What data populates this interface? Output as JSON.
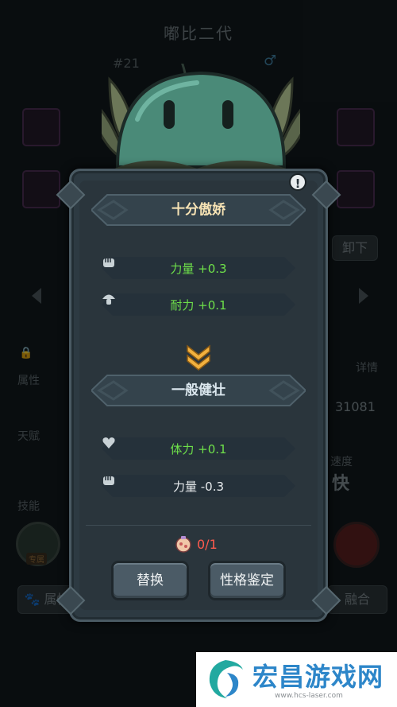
{
  "background": {
    "title": "嘟比二代",
    "number": "#21",
    "gender": "♂",
    "unequip_button": "卸下",
    "labels": {
      "attributes": "属性",
      "talent": "天赋",
      "skill": "技能",
      "details": "详情",
      "speed": "速度"
    },
    "values": {
      "power": "31081",
      "speed": "快"
    },
    "bottom_left_button": "属性",
    "bottom_right_button": "融合",
    "skill_badge": "专属"
  },
  "panel": {
    "help_icon": "!",
    "current_trait": {
      "name": "十分傲娇",
      "color": "#f7e3b4",
      "stats": [
        {
          "icon": "fist-icon",
          "text": "力量 +0.3",
          "color": "#6ee04a"
        },
        {
          "icon": "mushroom-icon",
          "text": "耐力 +0.1",
          "color": "#6ee04a"
        }
      ]
    },
    "new_trait": {
      "name": "一般健壮",
      "color": "#dbe7ee",
      "stats": [
        {
          "icon": "heart-icon",
          "text": "体力 +0.1",
          "color": "#6ee04a"
        },
        {
          "icon": "fist-icon",
          "text": "力量 -0.3",
          "color": "#e8ecee"
        }
      ]
    },
    "cost": "0/1",
    "cost_color": "#ff5a4e",
    "buttons": {
      "replace": "替换",
      "appraise": "性格鉴定"
    }
  },
  "watermark": {
    "brand": "宏昌游戏网",
    "url": "www.hcs-laser.com"
  },
  "colors": {
    "accent_orange": "#f2b13e",
    "positive": "#6ee04a",
    "negative_cost": "#ff5a4e"
  }
}
